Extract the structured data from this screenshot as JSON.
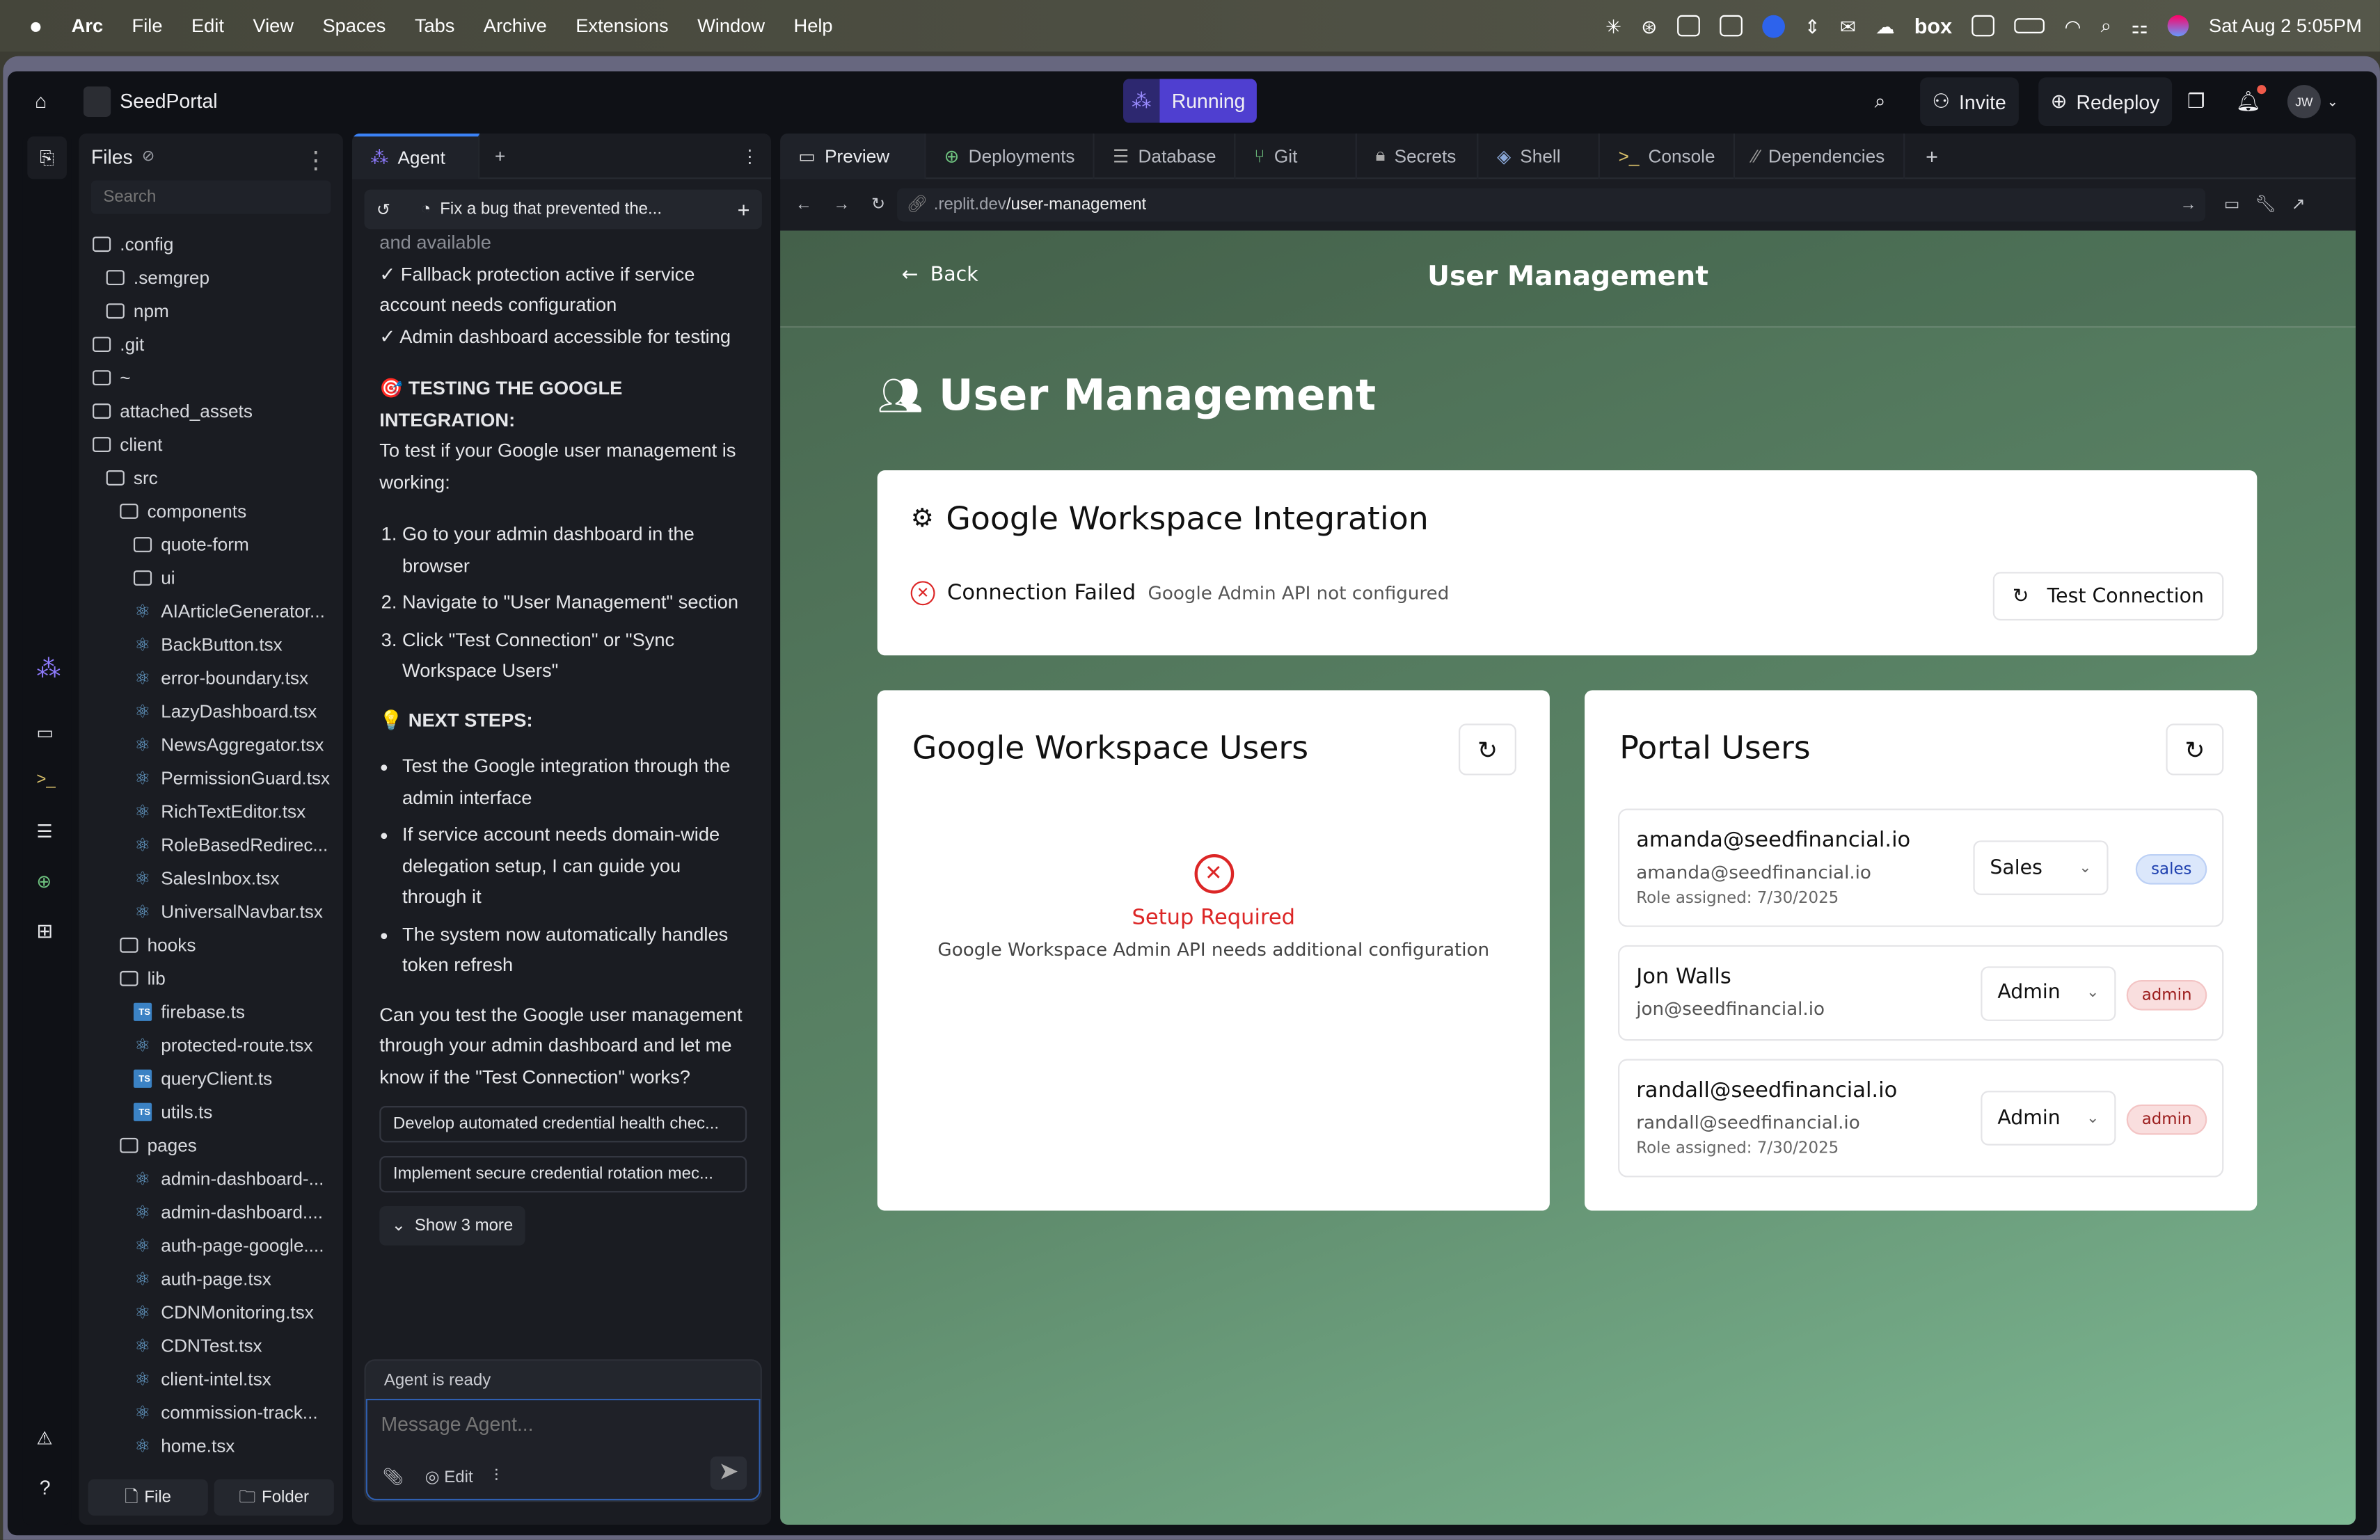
{
  "menubar": {
    "app": "Arc",
    "items": [
      "File",
      "Edit",
      "View",
      "Spaces",
      "Tabs",
      "Archive",
      "Extensions",
      "Window",
      "Help"
    ],
    "box": "box",
    "datetime": "Sat Aug 2  5:05PM"
  },
  "topbar": {
    "project": "SeedPortal",
    "run": "Running",
    "invite": "Invite",
    "redeploy": "Redeploy",
    "avatar": "JW"
  },
  "files": {
    "title": "Files",
    "search_placeholder": "Search",
    "file_btn": "File",
    "folder_btn": "Folder",
    "tree": [
      {
        "n": ".config",
        "t": "folder",
        "l": 0
      },
      {
        "n": ".semgrep",
        "t": "folder",
        "l": 1
      },
      {
        "n": "npm",
        "t": "folder",
        "l": 1
      },
      {
        "n": ".git",
        "t": "folder",
        "l": 0
      },
      {
        "n": "~",
        "t": "folder",
        "l": 0
      },
      {
        "n": "attached_assets",
        "t": "folder",
        "l": 0
      },
      {
        "n": "client",
        "t": "folder",
        "l": 0
      },
      {
        "n": "src",
        "t": "folder",
        "l": 1
      },
      {
        "n": "components",
        "t": "folder",
        "l": 2
      },
      {
        "n": "quote-form",
        "t": "folder",
        "l": 3
      },
      {
        "n": "ui",
        "t": "folder",
        "l": 3
      },
      {
        "n": "AIArticleGenerator...",
        "t": "react",
        "l": 3
      },
      {
        "n": "BackButton.tsx",
        "t": "react",
        "l": 3
      },
      {
        "n": "error-boundary.tsx",
        "t": "react",
        "l": 3
      },
      {
        "n": "LazyDashboard.tsx",
        "t": "react",
        "l": 3
      },
      {
        "n": "NewsAggregator.tsx",
        "t": "react",
        "l": 3
      },
      {
        "n": "PermissionGuard.tsx",
        "t": "react",
        "l": 3
      },
      {
        "n": "RichTextEditor.tsx",
        "t": "react",
        "l": 3
      },
      {
        "n": "RoleBasedRedirec...",
        "t": "react",
        "l": 3
      },
      {
        "n": "SalesInbox.tsx",
        "t": "react",
        "l": 3
      },
      {
        "n": "UniversalNavbar.tsx",
        "t": "react",
        "l": 3
      },
      {
        "n": "hooks",
        "t": "folder",
        "l": 2
      },
      {
        "n": "lib",
        "t": "folder",
        "l": 2
      },
      {
        "n": "firebase.ts",
        "t": "ts",
        "l": 3
      },
      {
        "n": "protected-route.tsx",
        "t": "react",
        "l": 3
      },
      {
        "n": "queryClient.ts",
        "t": "ts",
        "l": 3
      },
      {
        "n": "utils.ts",
        "t": "ts",
        "l": 3
      },
      {
        "n": "pages",
        "t": "folder",
        "l": 2
      },
      {
        "n": "admin-dashboard-...",
        "t": "react",
        "l": 3
      },
      {
        "n": "admin-dashboard....",
        "t": "react",
        "l": 3
      },
      {
        "n": "auth-page-google....",
        "t": "react",
        "l": 3
      },
      {
        "n": "auth-page.tsx",
        "t": "react",
        "l": 3
      },
      {
        "n": "CDNMonitoring.tsx",
        "t": "react",
        "l": 3
      },
      {
        "n": "CDNTest.tsx",
        "t": "react",
        "l": 3
      },
      {
        "n": "client-intel.tsx",
        "t": "react",
        "l": 3
      },
      {
        "n": "commission-track...",
        "t": "react",
        "l": 3
      },
      {
        "n": "home.tsx",
        "t": "react",
        "l": 3
      }
    ]
  },
  "agent": {
    "tab": "Agent",
    "thread": "Fix a bug that prevented the...",
    "faded": "and available",
    "checks": [
      "✓ Fallback protection active if service account needs configuration",
      "✓ Admin dashboard accessible for testing"
    ],
    "testing_heading": "🎯 TESTING THE GOOGLE INTEGRATION:",
    "testing_intro": "To test if your Google user management is working:",
    "steps": [
      "Go to your admin dashboard in the browser",
      "Navigate to \"User Management\" section",
      "Click \"Test Connection\" or \"Sync Workspace Users\""
    ],
    "next_heading": "💡 NEXT STEPS:",
    "next": [
      "Test the Google integration through the admin interface",
      "If service account needs domain-wide delegation setup, I can guide you through it",
      "The system now automatically handles token refresh"
    ],
    "question": "Can you test the Google user management through your admin dashboard and let me know if the \"Test Connection\" works?",
    "suggestions": [
      "Develop automated credential health chec...",
      "Implement secure credential rotation mec..."
    ],
    "show_more": "Show 3 more",
    "status": "Agent is ready",
    "placeholder": "Message Agent...",
    "edit": "Edit"
  },
  "tabs": [
    "Preview",
    "Deployments",
    "Database",
    "Git",
    "Secrets",
    "Shell",
    "Console",
    "Dependencies"
  ],
  "url": {
    "host": ".replit.dev",
    "path": "/user-management"
  },
  "page": {
    "back": "Back",
    "header_title": "User Management",
    "h1": "User Management",
    "integration": {
      "title": "Google Workspace Integration",
      "status": "Connection Failed",
      "detail": "Google Admin API not configured",
      "button": "Test Connection"
    },
    "gw": {
      "title": "Google Workspace Users",
      "error_title": "Setup Required",
      "error_detail": "Google Workspace Admin API needs additional configuration"
    },
    "portal": {
      "title": "Portal Users",
      "users": [
        {
          "name": "amanda@seedfinancial.io",
          "email": "amanda@seedfinancial.io",
          "assigned": "Role assigned: 7/30/2025",
          "role": "Sales",
          "badge": "sales"
        },
        {
          "name": "Jon Walls",
          "email": "jon@seedfinancial.io",
          "role": "Admin",
          "badge": "admin"
        },
        {
          "name": "randall@seedfinancial.io",
          "email": "randall@seedfinancial.io",
          "assigned": "Role assigned: 7/30/2025",
          "role": "Admin",
          "badge": "admin"
        }
      ]
    }
  },
  "colors": {
    "accent": "#4f3fd0",
    "error": "#dc2626",
    "sales_badge": "#dbe7fb",
    "admin_badge": "#f9dede"
  }
}
